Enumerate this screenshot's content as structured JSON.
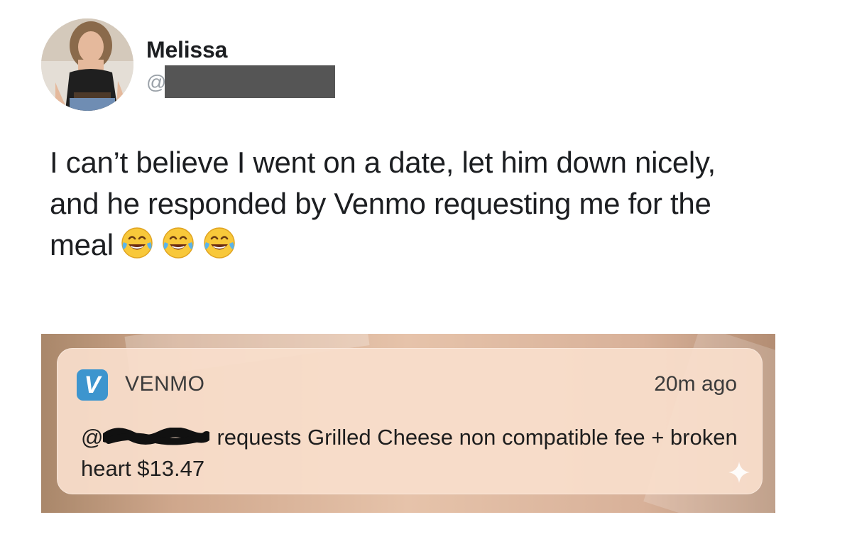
{
  "tweet": {
    "display_name": "Melissa",
    "handle_prefix": "@",
    "text": "I can’t believe I went on a date, let him down nicely, and he responded by Venmo requesting me for the meal",
    "emoji": [
      "face-with-tears-of-joy",
      "face-with-tears-of-joy",
      "face-with-tears-of-joy"
    ]
  },
  "notification": {
    "app_icon_letter": "V",
    "app_name": "VENMO",
    "time": "20m ago",
    "handle_prefix": "@",
    "message": "requests Grilled Cheese non compatible fee + broken heart $13.47"
  },
  "colors": {
    "venmo_blue": "#3d95ce",
    "redaction": "#555555"
  }
}
